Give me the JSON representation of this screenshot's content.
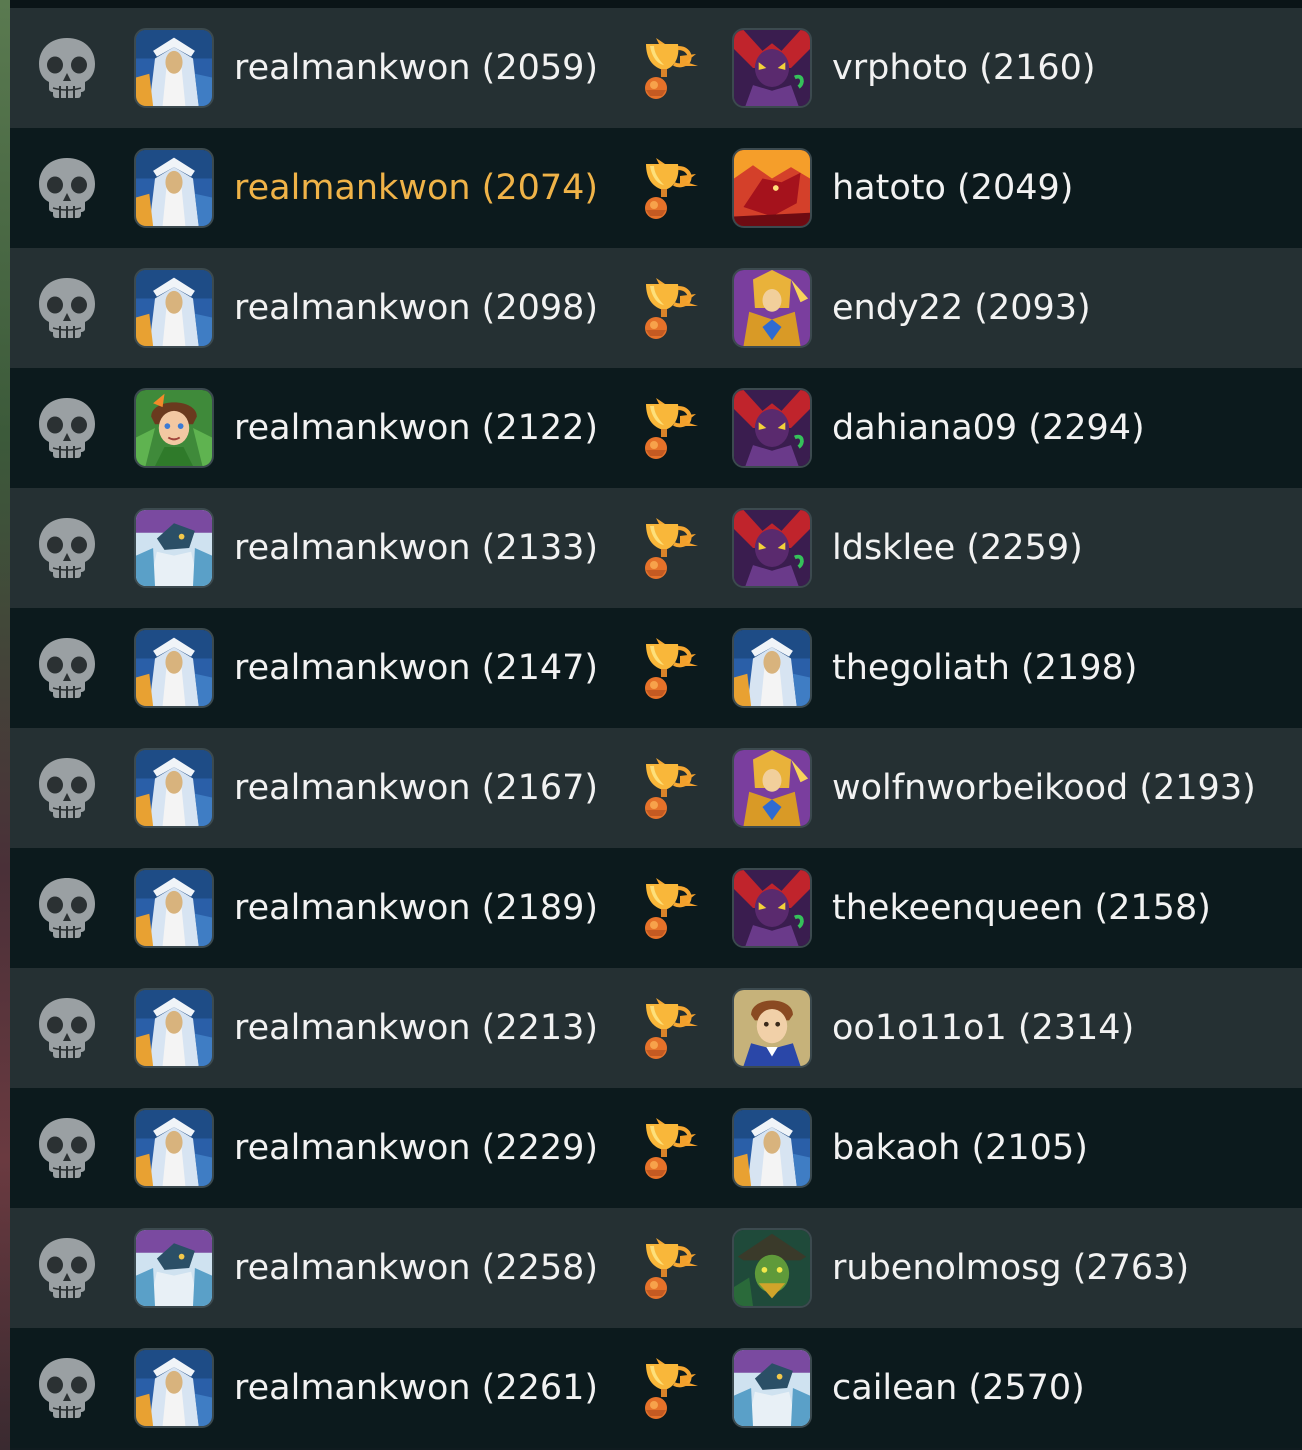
{
  "battles": [
    {
      "left": {
        "name": "realmankwon (2059)",
        "avatar": "wizard-portrait"
      },
      "right": {
        "name": "vrphoto (2160)",
        "avatar": "demon-portrait"
      },
      "highlight_left": false
    },
    {
      "left": {
        "name": "realmankwon (2074)",
        "avatar": "wizard-portrait"
      },
      "right": {
        "name": "hatoto (2049)",
        "avatar": "fire-dragon-portrait"
      },
      "highlight_left": true
    },
    {
      "left": {
        "name": "realmankwon (2098)",
        "avatar": "wizard-portrait"
      },
      "right": {
        "name": "endy22 (2093)",
        "avatar": "golden-knight-portrait"
      },
      "highlight_left": false
    },
    {
      "left": {
        "name": "realmankwon (2122)",
        "avatar": "earth-elf-portrait"
      },
      "right": {
        "name": "dahiana09 (2294)",
        "avatar": "demon-portrait"
      },
      "highlight_left": false
    },
    {
      "left": {
        "name": "realmankwon (2133)",
        "avatar": "dragon-sage-portrait"
      },
      "right": {
        "name": "ldsklee (2259)",
        "avatar": "demon-portrait"
      },
      "highlight_left": false
    },
    {
      "left": {
        "name": "realmankwon (2147)",
        "avatar": "wizard-portrait"
      },
      "right": {
        "name": "thegoliath (2198)",
        "avatar": "wizard-portrait"
      },
      "highlight_left": false
    },
    {
      "left": {
        "name": "realmankwon (2167)",
        "avatar": "wizard-portrait"
      },
      "right": {
        "name": "wolfnworbeikood (2193)",
        "avatar": "golden-knight-portrait"
      },
      "highlight_left": false
    },
    {
      "left": {
        "name": "realmankwon (2189)",
        "avatar": "wizard-portrait"
      },
      "right": {
        "name": "thekeenqueen (2158)",
        "avatar": "demon-portrait"
      },
      "highlight_left": false
    },
    {
      "left": {
        "name": "realmankwon (2213)",
        "avatar": "wizard-portrait"
      },
      "right": {
        "name": "oo1o11o1 (2314)",
        "avatar": "young-noble-portrait"
      },
      "highlight_left": false
    },
    {
      "left": {
        "name": "realmankwon (2229)",
        "avatar": "wizard-portrait"
      },
      "right": {
        "name": "bakaoh (2105)",
        "avatar": "wizard-portrait"
      },
      "highlight_left": false
    },
    {
      "left": {
        "name": "realmankwon (2258)",
        "avatar": "dragon-sage-portrait"
      },
      "right": {
        "name": "rubenolmosg (2763)",
        "avatar": "green-witch-portrait"
      },
      "highlight_left": false
    },
    {
      "left": {
        "name": "realmankwon (2261)",
        "avatar": "wizard-portrait"
      },
      "right": {
        "name": "cailean (2570)",
        "avatar": "dragon-sage-portrait"
      },
      "highlight_left": false
    }
  ],
  "icons": {
    "loss": "skull-icon",
    "win": "trophy-icon"
  },
  "colors": {
    "highlight_name": "#f0b348",
    "name": "#f2f2f2",
    "row_light": "#253033",
    "row_dark": "#0c1a1d"
  }
}
